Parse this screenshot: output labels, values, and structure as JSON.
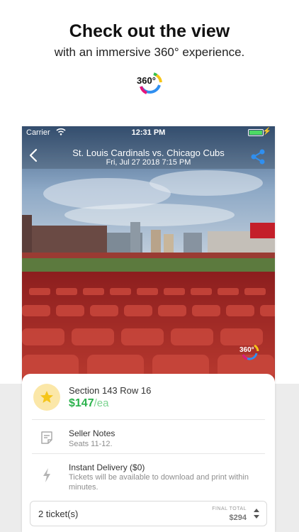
{
  "promo": {
    "headline": "Check out the view",
    "subline": "with an immersive 360° experience.",
    "logo_text": "360°"
  },
  "status_bar": {
    "carrier": "Carrier",
    "time": "12:31 PM"
  },
  "event": {
    "title": "St. Louis Cardinals vs. Chicago Cubs",
    "datetime": "Fri, Jul 27 2018 7:15 PM"
  },
  "view_badge": "360°",
  "listing": {
    "section_row": "Section 143 Row 16",
    "price": "$147",
    "price_unit": "/ea",
    "seller_notes_title": "Seller Notes",
    "seller_notes_text": "Seats 11-12.",
    "delivery_title": "Instant Delivery ($0)",
    "delivery_text": "Tickets will be available to download and print within minutes."
  },
  "purchase": {
    "tickets_value": "2 ticket(s)",
    "final_total_label": "FINAL TOTAL",
    "final_total_value": "$294"
  },
  "colors": {
    "accent_blue": "#2f8ff0",
    "price_green": "#2bb24c",
    "star_yellow": "#f5c518",
    "battery_green": "#4cd964"
  },
  "icons": [
    "wifi-icon",
    "battery-icon",
    "back-chevron-icon",
    "share-icon",
    "star-icon",
    "notes-icon",
    "lightning-icon",
    "stepper-icon",
    "360-logo-icon"
  ]
}
